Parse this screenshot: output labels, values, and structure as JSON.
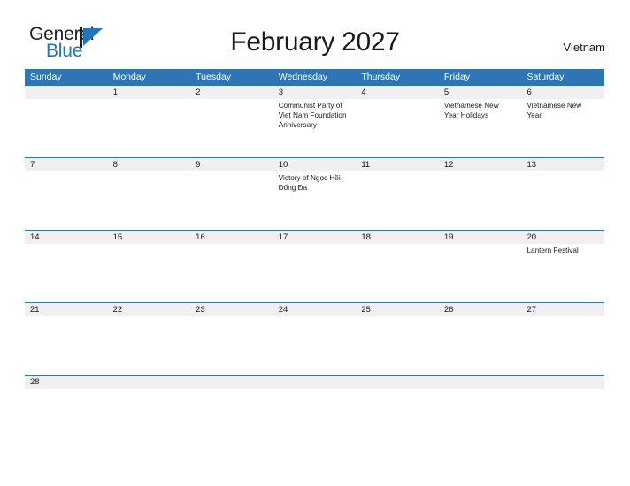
{
  "logo": {
    "text_top": "General",
    "text_bottom": "Blue",
    "accent_color": "#1f76bc",
    "dark_color": "#231f20",
    "triangle_icon": "triangle-right-icon"
  },
  "header": {
    "title": "February 2027",
    "country": "Vietnam"
  },
  "theme": {
    "header_blue": "#2e75b6",
    "date_band_gray": "#f0f0f0",
    "text_color": "#1a1a1a"
  },
  "weekdays": [
    "Sunday",
    "Monday",
    "Tuesday",
    "Wednesday",
    "Thursday",
    "Friday",
    "Saturday"
  ],
  "weeks": [
    {
      "dates": [
        "",
        "1",
        "2",
        "3",
        "4",
        "5",
        "6"
      ],
      "events": [
        "",
        "",
        "",
        "Communist Party of Viet Nam Foundation Anniversary",
        "",
        "Vietnamese New Year Holidays",
        "Vietnamese New Year"
      ]
    },
    {
      "dates": [
        "7",
        "8",
        "9",
        "10",
        "11",
        "12",
        "13"
      ],
      "events": [
        "",
        "",
        "",
        "Victory of Ngọc Hồi-Đống Đa",
        "",
        "",
        ""
      ]
    },
    {
      "dates": [
        "14",
        "15",
        "16",
        "17",
        "18",
        "19",
        "20"
      ],
      "events": [
        "",
        "",
        "",
        "",
        "",
        "",
        "Lantern Festival"
      ]
    },
    {
      "dates": [
        "21",
        "22",
        "23",
        "24",
        "25",
        "26",
        "27"
      ],
      "events": [
        "",
        "",
        "",
        "",
        "",
        "",
        ""
      ]
    },
    {
      "dates": [
        "28",
        "",
        "",
        "",
        "",
        "",
        ""
      ],
      "events": [
        "",
        "",
        "",
        "",
        "",
        "",
        ""
      ]
    }
  ]
}
